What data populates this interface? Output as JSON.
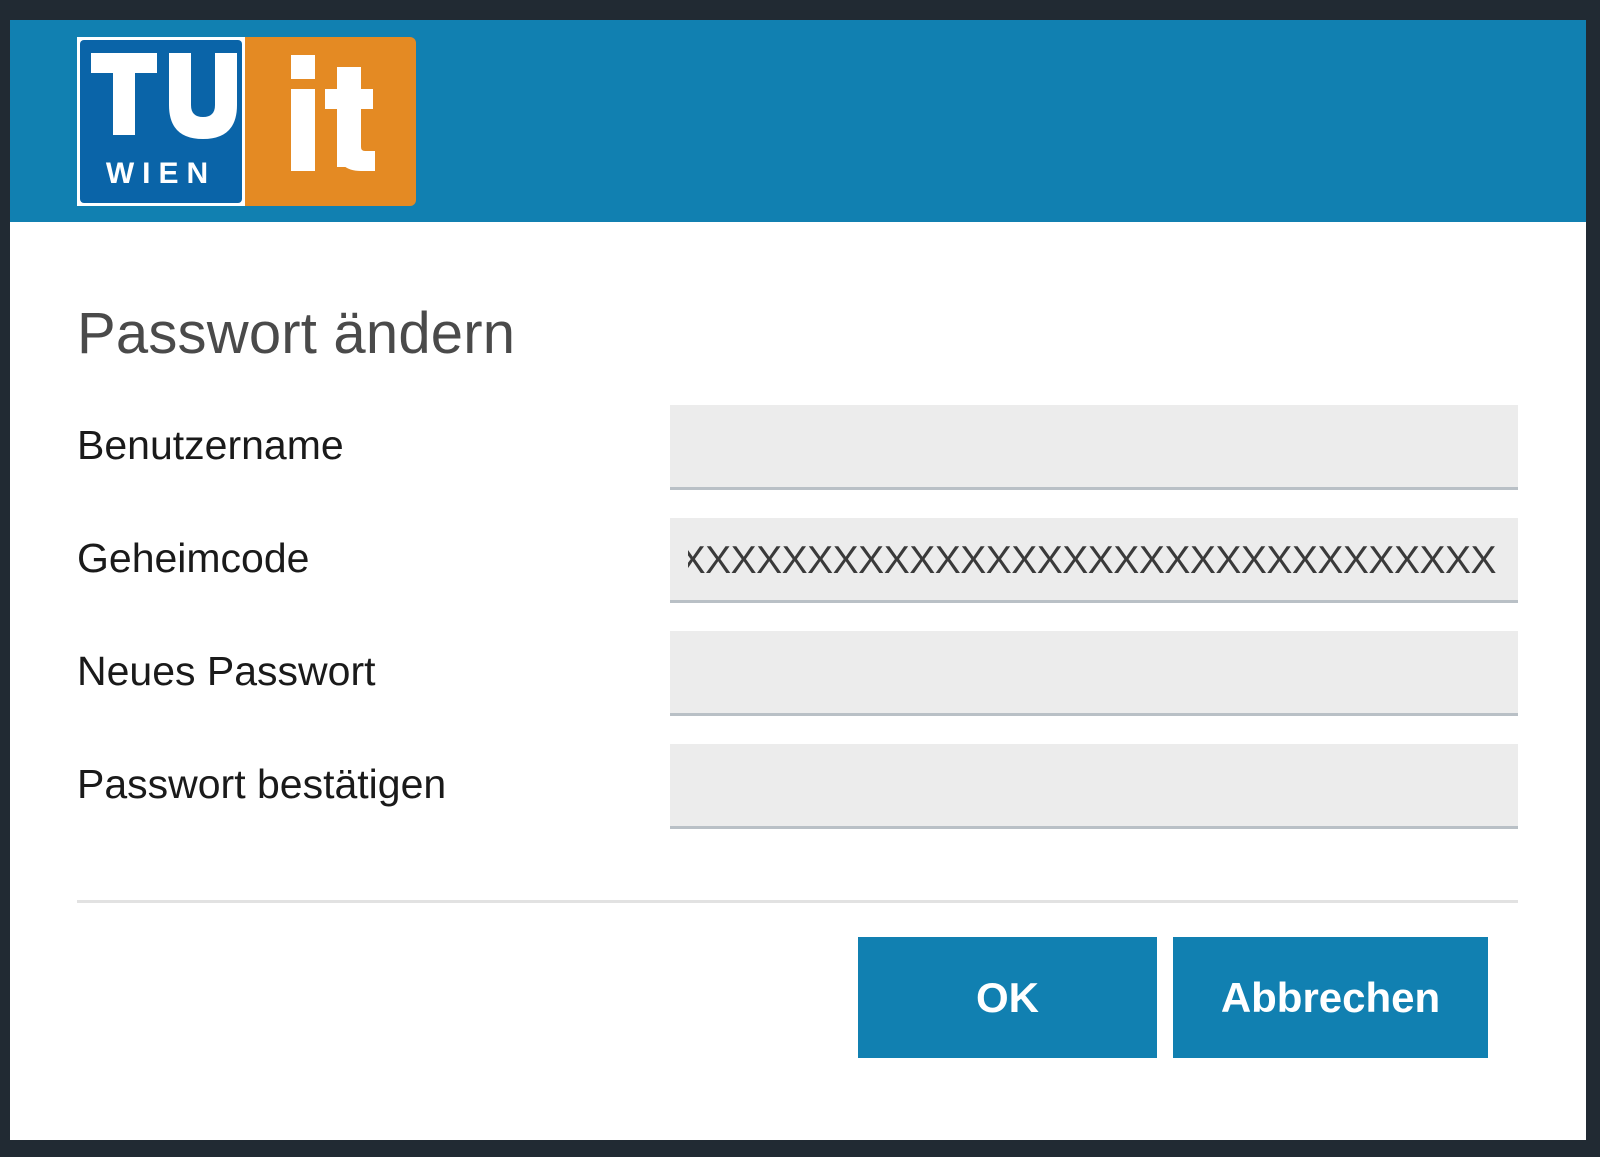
{
  "logo": {
    "tu_text": "TU",
    "wien_text": "WIEN",
    "it_text": "it",
    "colors": {
      "tu": "#0a64a8",
      "it": "#e48a23"
    }
  },
  "colors": {
    "header": "#1180b1",
    "button": "#1180b1",
    "field_bg": "#ececec"
  },
  "dialog": {
    "title": "Passwort ändern"
  },
  "form": {
    "username": {
      "label": "Benutzername",
      "value": ""
    },
    "secret": {
      "label": "Geheimcode",
      "value": "XXXXXXXXXXXXXXXXXXXXXXXXXXXXXXXXXX"
    },
    "new_password": {
      "label": "Neues Passwort",
      "value": ""
    },
    "confirm_password": {
      "label": "Passwort bestätigen",
      "value": ""
    }
  },
  "buttons": {
    "ok": "OK",
    "cancel": "Abbrechen"
  }
}
